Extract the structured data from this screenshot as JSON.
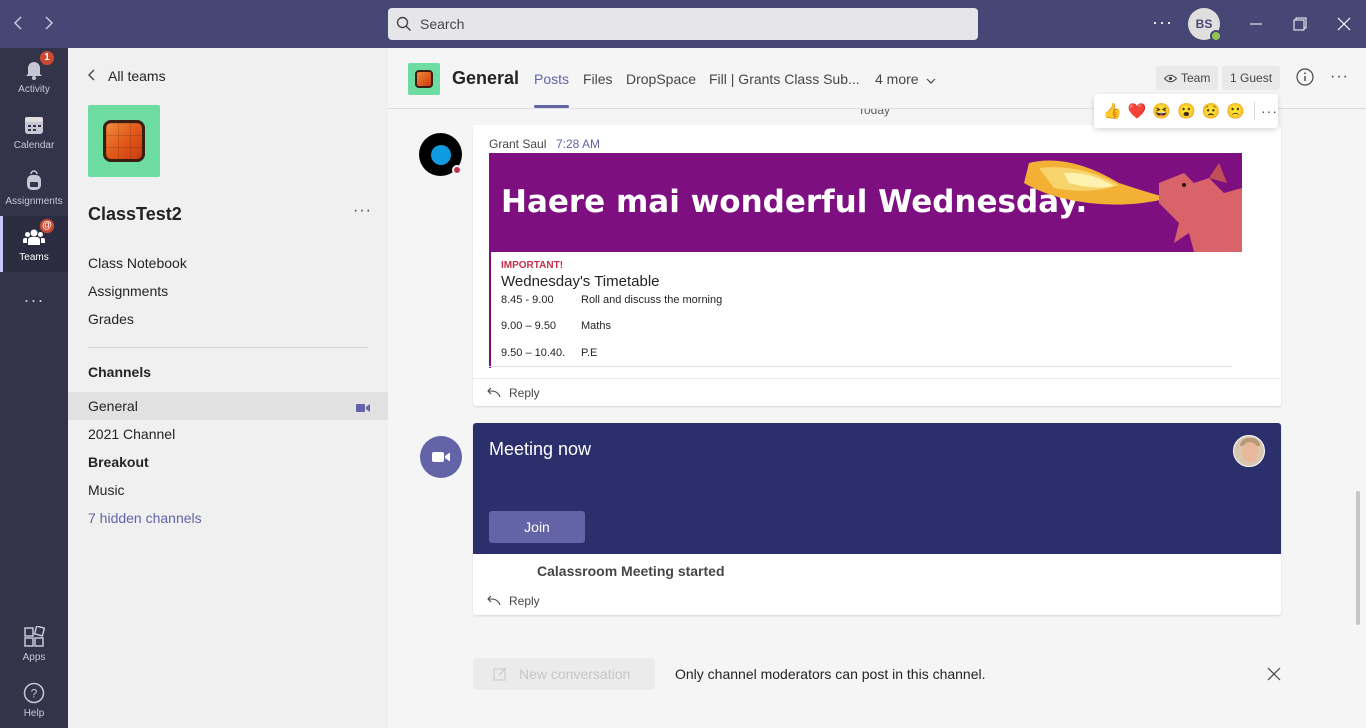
{
  "titlebar": {
    "search_placeholder": "Search",
    "avatar_initials": "BS",
    "more_label": "···"
  },
  "rail": {
    "items": [
      {
        "label": "Activity",
        "badge": "1"
      },
      {
        "label": "Calendar"
      },
      {
        "label": "Assignments"
      },
      {
        "label": "Teams",
        "badge": "@"
      },
      {
        "label": "···"
      },
      {
        "label": "Apps"
      },
      {
        "label": "Help"
      }
    ]
  },
  "sidebar": {
    "back_label": "All teams",
    "team_name": "ClassTest2",
    "more_label": "···",
    "links": [
      "Class Notebook",
      "Assignments",
      "Grades"
    ],
    "channels_heading": "Channels",
    "channels": [
      "General",
      "2021 Channel",
      "Breakout",
      "Music",
      "7 hidden channels"
    ]
  },
  "header": {
    "channel_title": "General",
    "tabs": [
      "Posts",
      "Files",
      "DropSpace",
      "Fill | Grants Class Sub...",
      "4 more"
    ],
    "team_pill": "Team",
    "guest_pill": "1 Guest",
    "more_label": "···"
  },
  "messages": {
    "day_label": "Today",
    "post": {
      "author": "Grant Saul",
      "time": "7:28 AM",
      "banner_text": "Haere mai wonderful Wednesday.",
      "important_label": "IMPORTANT!",
      "timetable_title": "Wednesday's Timetable",
      "timetable": [
        {
          "time": "8.45 - 9.00",
          "activity": "Roll and discuss the morning"
        },
        {
          "time": "9.00 – 9.50",
          "activity": "Maths"
        },
        {
          "time": "9.50 – 10.40.",
          "activity": "P.E"
        }
      ],
      "reply_label": "Reply"
    },
    "reactions": [
      "👍",
      "❤️",
      "😆",
      "😮",
      "😟",
      "🙁"
    ],
    "meeting": {
      "title": "Meeting now",
      "join_label": "Join",
      "started_text": "Calassroom Meeting started",
      "reply_label": "Reply"
    }
  },
  "compose": {
    "new_conversation_label": "New conversation",
    "notice": "Only channel moderators can post in this channel."
  },
  "colors": {
    "titlebar": "#464775",
    "rail": "#33344a",
    "accent": "#6264a7",
    "banner": "#7e0f80",
    "meeting_banner": "#2b2f6b",
    "team_logo_bg": "#6cdca0"
  }
}
